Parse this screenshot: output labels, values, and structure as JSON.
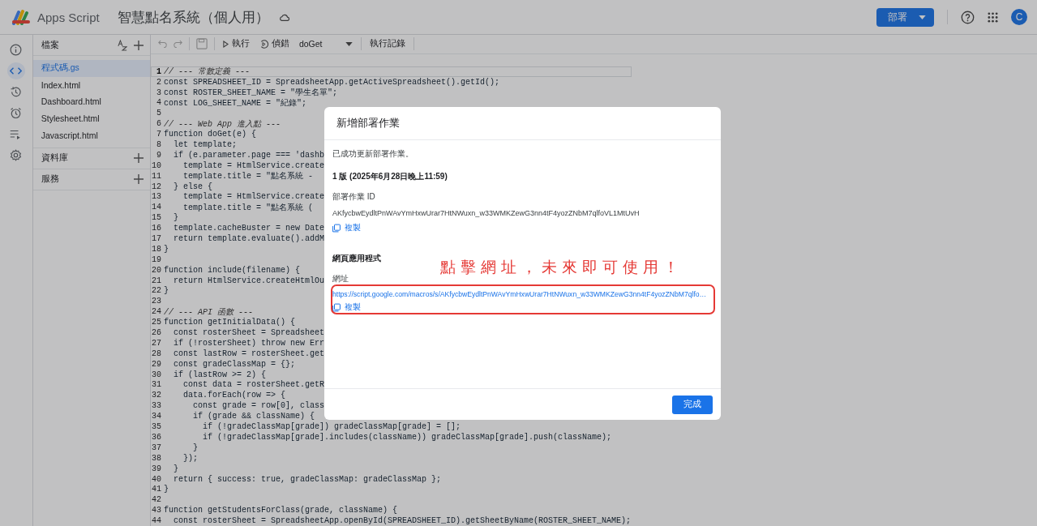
{
  "app_bar": {
    "product": "Apps Script",
    "project_title": "智慧點名系統（個人用）",
    "deploy_button": "部署",
    "avatar_letter": "C"
  },
  "rail": [
    {
      "selected": false
    },
    {
      "selected": true
    },
    {
      "selected": false
    },
    {
      "selected": false
    },
    {
      "selected": false
    },
    {
      "selected": false
    }
  ],
  "files_panel": {
    "title": "檔案",
    "files": [
      {
        "name": "程式碼.gs",
        "selected": true
      },
      {
        "name": "Index.html",
        "selected": false
      },
      {
        "name": "Dashboard.html",
        "selected": false
      },
      {
        "name": "Stylesheet.html",
        "selected": false
      },
      {
        "name": "Javascript.html",
        "selected": false
      }
    ],
    "sections": [
      "資料庫",
      "服務"
    ]
  },
  "toolbar": {
    "run": "執行",
    "debug": "偵錯",
    "function": "doGet",
    "log": "執行記錄"
  },
  "code_lines": [
    {
      "number": "1",
      "kind": "comment",
      "text": "// --- 常數定義 ---",
      "active": true
    },
    {
      "number": "2",
      "kind": "code",
      "text": "const SPREADSHEET_ID = SpreadsheetApp.getActiveSpreadsheet().getId();",
      "active": false
    },
    {
      "number": "3",
      "kind": "code",
      "text": "const ROSTER_SHEET_NAME = \"學生名單\";",
      "active": false
    },
    {
      "number": "4",
      "kind": "code",
      "text": "const LOG_SHEET_NAME = \"紀錄\";",
      "active": false
    },
    {
      "number": "5",
      "active": false
    },
    {
      "number": "6",
      "kind": "comment",
      "text": "// --- Web App 進入點 ---",
      "active": false
    },
    {
      "number": "7",
      "kind": "code",
      "text": "function doGet(e) {",
      "active": false
    },
    {
      "number": "8",
      "kind": "code",
      "text": "  let template;",
      "active": false
    },
    {
      "number": "9",
      "kind": "code",
      "text": "  if (e.parameter.page === 'dashb",
      "active": false
    },
    {
      "number": "10",
      "kind": "code",
      "text": "    template = HtmlService.create",
      "active": false
    },
    {
      "number": "11",
      "kind": "code",
      "text": "    template.title = \"點名系統 - ",
      "active": false
    },
    {
      "number": "12",
      "kind": "code",
      "text": "  } else {",
      "active": false
    },
    {
      "number": "13",
      "kind": "code",
      "text": "    template = HtmlService.create",
      "active": false
    },
    {
      "number": "14",
      "kind": "code",
      "text": "    template.title = \"點名系統 (",
      "active": false
    },
    {
      "number": "15",
      "kind": "code",
      "text": "  }",
      "active": false
    },
    {
      "number": "16",
      "kind": "code",
      "text": "  template.cacheBuster = new Date",
      "active": false
    },
    {
      "number": "17",
      "kind": "code",
      "text": "  return template.evaluate().addM",
      "active": false
    },
    {
      "number": "18",
      "kind": "code",
      "text": "}",
      "active": false
    },
    {
      "number": "19",
      "active": false
    },
    {
      "number": "20",
      "kind": "code",
      "text": "function include(filename) {",
      "active": false
    },
    {
      "number": "21",
      "kind": "code",
      "text": "  return HtmlService.createHtmlOu",
      "active": false
    },
    {
      "number": "22",
      "kind": "code",
      "text": "}",
      "active": false
    },
    {
      "number": "23",
      "active": false
    },
    {
      "number": "24",
      "kind": "comment",
      "text": "// --- API 函數 ---",
      "active": false
    },
    {
      "number": "25",
      "kind": "code",
      "text": "function getInitialData() {",
      "active": false
    },
    {
      "number": "26",
      "kind": "code",
      "text": "  const rosterSheet = Spreadsheet",
      "active": false
    },
    {
      "number": "27",
      "kind": "code",
      "text": "  if (!rosterSheet) throw new Err",
      "active": false
    },
    {
      "number": "28",
      "kind": "code",
      "text": "  const lastRow = rosterSheet.get",
      "active": false
    },
    {
      "number": "29",
      "kind": "code",
      "text": "  const gradeClassMap = {};",
      "active": false
    },
    {
      "number": "30",
      "kind": "code",
      "text": "  if (lastRow >= 2) {",
      "active": false
    },
    {
      "number": "31",
      "kind": "code",
      "text": "    const data = rosterSheet.getR",
      "active": false
    },
    {
      "number": "32",
      "kind": "code",
      "text": "    data.forEach(row => {",
      "active": false
    },
    {
      "number": "33",
      "kind": "code",
      "text": "      const grade = row[0], class",
      "active": false
    },
    {
      "number": "34",
      "kind": "code",
      "text": "      if (grade && className) {",
      "active": false
    },
    {
      "number": "35",
      "kind": "code",
      "text": "        if (!gradeClassMap[grade]) gradeClassMap[grade] = [];",
      "active": false
    },
    {
      "number": "36",
      "kind": "code",
      "text": "        if (!gradeClassMap[grade].includes(className)) gradeClassMap[grade].push(className);",
      "active": false
    },
    {
      "number": "37",
      "kind": "code",
      "text": "      }",
      "active": false
    },
    {
      "number": "38",
      "kind": "code",
      "text": "    });",
      "active": false
    },
    {
      "number": "39",
      "kind": "code",
      "text": "  }",
      "active": false
    },
    {
      "number": "40",
      "kind": "code",
      "text": "  return { success: true, gradeClassMap: gradeClassMap };",
      "active": false
    },
    {
      "number": "41",
      "kind": "code",
      "text": "}",
      "active": false
    },
    {
      "number": "42",
      "active": false
    },
    {
      "number": "43",
      "kind": "code",
      "text": "function getStudentsForClass(grade, className) {",
      "active": false
    },
    {
      "number": "44",
      "kind": "code",
      "text": "  const rosterSheet = SpreadsheetApp.openById(SPREADSHEET_ID).getSheetByName(ROSTER_SHEET_NAME);",
      "active": false
    }
  ],
  "dialog": {
    "title": "新增部署作業",
    "message": "已成功更新部署作業。",
    "version": "1 版 (2025年6月28日晚上11:59)",
    "id_label": "部署作業 ID",
    "deployment_id": "AKfycbwEydltPnWAvYmHxwUrar7HtNWuxn_w33WMKZewG3nn4tF4yozZNbM7qlfoVL1MtUvH",
    "copy_id": "複製",
    "web_app_heading": "網頁應用程式",
    "url_label": "網址",
    "url": "https://script.google.com/macros/s/AKfycbwEydltPnWAvYmHxwUrar7HtNWuxn_w33WMKZewG3nn4tF4yozZNbM7qlfo…",
    "copy_url": "複製",
    "done_button": "完成"
  },
  "annotation": {
    "text": "點擊網址，未來即可使用！"
  }
}
